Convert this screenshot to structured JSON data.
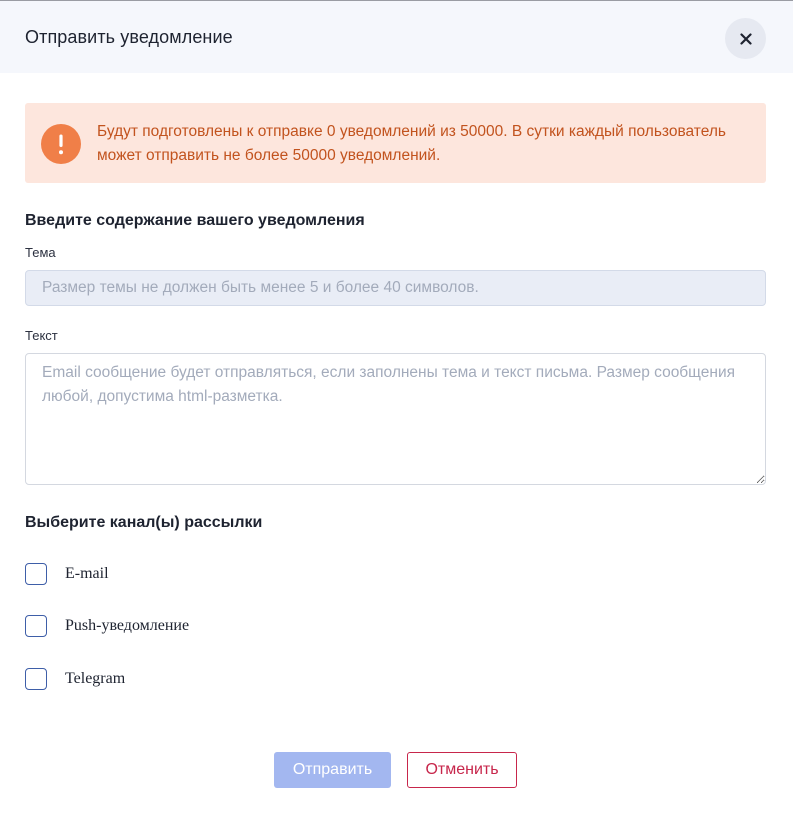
{
  "dialog": {
    "title": "Отправить уведомление",
    "close_icon": "close-icon"
  },
  "alert": {
    "icon": "exclamation-circle-icon",
    "text": "Будут подготовлены к отправке 0 уведомлений из 50000. В сутки каждый пользователь может отправить не более 50000 уведомлений.",
    "color": "#c2531e",
    "background": "#fde6dd"
  },
  "content_section": {
    "title": "Введите содержание вашего уведомления",
    "subject": {
      "label": "Тема",
      "value": "",
      "placeholder": "Размер темы не должен быть менее 5 и более 40 символов."
    },
    "text": {
      "label": "Текст",
      "value": "",
      "placeholder": "Email сообщение будет отправляться, если заполнены тема и текст письма. Размер сообщения любой, допустима html-разметка."
    }
  },
  "channels_section": {
    "title": "Выберите канал(ы) рассылки",
    "channels": [
      {
        "label": "E-mail",
        "checked": false
      },
      {
        "label": "Push-уведомление",
        "checked": false
      },
      {
        "label": "Telegram",
        "checked": false
      }
    ]
  },
  "actions": {
    "send_label": "Отправить",
    "cancel_label": "Отменить",
    "send_color": "#a3b7f0",
    "cancel_color": "#c7264b"
  }
}
